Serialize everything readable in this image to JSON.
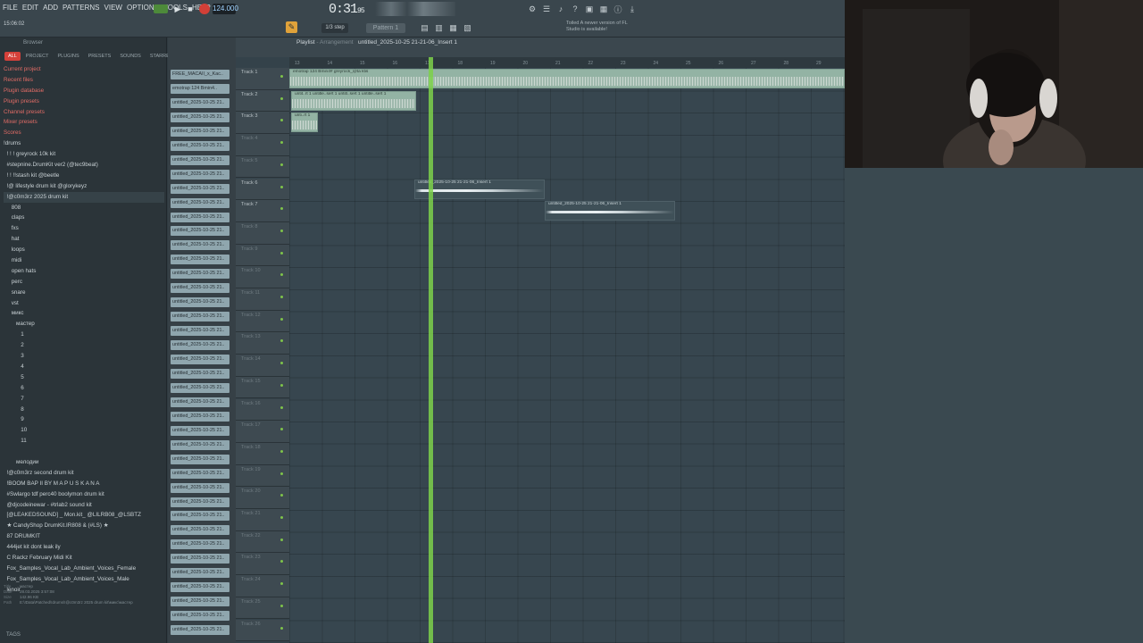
{
  "menu": [
    "FILE",
    "EDIT",
    "ADD",
    "PATTERNS",
    "VIEW",
    "OPTIONS",
    "TOOLS",
    "HELP"
  ],
  "transport": {
    "tempo": "124.000",
    "time": "0:31",
    "time_small": "95",
    "song_pos": "15:06:02",
    "pattern": "Pattern 1",
    "snap": "1/3 step",
    "hint": "Toiled A newer version of FL Studio is available!"
  },
  "browser": {
    "title": "Browser",
    "tabs": [
      "ALL",
      "PROJECT",
      "PLUGINS",
      "PRESETS",
      "SOUNDS",
      "STARRED"
    ],
    "tree": [
      {
        "label": "Current project",
        "red": true
      },
      {
        "label": "Recent files",
        "red": true
      },
      {
        "label": "Plugin database",
        "red": true
      },
      {
        "label": "Plugin presets",
        "red": true
      },
      {
        "label": "Channel presets",
        "red": true
      },
      {
        "label": "Mixer presets",
        "red": true
      },
      {
        "label": "Scores",
        "red": true
      },
      {
        "label": "!drums"
      },
      {
        "label": "  ! ! ! greyrock 10k kit"
      },
      {
        "label": "  #stepnine.DrumKit ver2 (@tec9beat)"
      },
      {
        "label": "  ! ! !!stash kit @beetle"
      },
      {
        "label": "  !@ lifestyle drum kit @glorykeyz"
      },
      {
        "label": "  !@c0m3rz 2025 drum kit",
        "sel": true
      },
      {
        "label": "     808"
      },
      {
        "label": "     claps"
      },
      {
        "label": "     fxs"
      },
      {
        "label": "     hat"
      },
      {
        "label": "     loops"
      },
      {
        "label": "     midi"
      },
      {
        "label": "     open hats"
      },
      {
        "label": "     perc"
      },
      {
        "label": "     snare"
      },
      {
        "label": "     vst"
      },
      {
        "label": "     микс"
      },
      {
        "label": "        мастер"
      },
      {
        "label": "           1"
      },
      {
        "label": "           2"
      },
      {
        "label": "           3"
      },
      {
        "label": "           4"
      },
      {
        "label": "           5"
      },
      {
        "label": "           6"
      },
      {
        "label": "           7"
      },
      {
        "label": "           8"
      },
      {
        "label": "           9"
      },
      {
        "label": "           10"
      },
      {
        "label": "           11"
      },
      {
        "label": ""
      },
      {
        "label": "        мелодии"
      },
      {
        "label": "  !@c0m3rz second drum kit"
      },
      {
        "label": "  !BOOM BAP II BY M A P U S K A N A"
      },
      {
        "label": "  #Swlargo tdf perc40 boolymon drum kit"
      },
      {
        "label": "  @djcodeinewar - #trlab2 sound kit"
      },
      {
        "label": "  [@LEAKEDSOUND] _ Mon.kit_ @LILRB08_@LSBTZ"
      },
      {
        "label": "  ★ CandyShop DrumKit.IR808 & (#LS) ★"
      },
      {
        "label": "  87 DRUMKIT"
      },
      {
        "label": "  444jet kit dont leak ily"
      },
      {
        "label": "  C Rackz February Midi Kit"
      },
      {
        "label": "  Fox_Samples_Vocal_Lab_Ambient_Voices_Female"
      },
      {
        "label": "  Fox_Samples_Vocal_Lab_Ambient_Voices_Male"
      },
      {
        "label": "  lenoir"
      }
    ],
    "info": [
      {
        "k": "Title",
        "v": "мастер"
      },
      {
        "k": "Date",
        "v": "28.03.2025 3:57:08"
      },
      {
        "k": "Size",
        "v": "142.96 KB"
      },
      {
        "k": "Path",
        "v": "E:\\!Data\\Patched\\!drums\\!@c0m3rz 2025 drum kit\\микс\\мастер"
      }
    ],
    "footer": "TAGS"
  },
  "picker": {
    "items": [
      "FREE_MACAII_x_Kac..",
      "emotrap 124 Bmin4..",
      "untitled_2025-10-25 21..",
      "untitled_2025-10-25 21..",
      "untitled_2025-10-25 21..",
      "untitled_2025-10-25 21..",
      "untitled_2025-10-25 21..",
      "untitled_2025-10-25 21..",
      "untitled_2025-10-25 21..",
      "untitled_2025-10-25 21..",
      "untitled_2025-10-25 21..",
      "untitled_2025-10-25 21..",
      "untitled_2025-10-25 21..",
      "untitled_2025-10-25 21..",
      "untitled_2025-10-25 21..",
      "untitled_2025-10-25 21..",
      "untitled_2025-10-25 21..",
      "untitled_2025-10-25 21..",
      "untitled_2025-10-25 21..",
      "untitled_2025-10-25 21..",
      "untitled_2025-10-25 21..",
      "untitled_2025-10-25 21..",
      "untitled_2025-10-25 21..",
      "untitled_2025-10-25 21..",
      "untitled_2025-10-25 21..",
      "untitled_2025-10-25 21..",
      "untitled_2025-10-25 21..",
      "untitled_2025-10-25 21..",
      "untitled_2025-10-25 21..",
      "untitled_2025-10-25 21..",
      "untitled_2025-10-25 21..",
      "untitled_2025-10-25 21..",
      "untitled_2025-10-25 21..",
      "untitled_2025-10-25 21..",
      "untitled_2025-10-25 21..",
      "untitled_2025-10-25 21..",
      "untitled_2025-10-25 21..",
      "untitled_2025-10-25 21..",
      "untitled_2025-10-25 21..",
      "untitled_2025-10-25 21.."
    ]
  },
  "playlist": {
    "title": "Playlist",
    "subtitle": "- Arrangement",
    "pattern": "untitled_2025-10-25 21-21-06_Insert 1",
    "ruler": [
      "13",
      "14",
      "15",
      "16",
      "17",
      "18",
      "19",
      "20",
      "21",
      "22",
      "23",
      "24",
      "25",
      "26",
      "27",
      "28",
      "29"
    ],
    "tracks": [
      "Track 1",
      "Track 2",
      "Track 3",
      "Track 4",
      "Track 5",
      "Track 6",
      "Track 7",
      "Track 8",
      "Track 9",
      "Track 10",
      "Track 11",
      "Track 12",
      "Track 13",
      "Track 14",
      "Track 15",
      "Track 16",
      "Track 17",
      "Track 18",
      "Track 19",
      "Track 20",
      "Track 21",
      "Track 22",
      "Track 23",
      "Track 24",
      "Track 25",
      "Track 26"
    ],
    "clips": [
      {
        "label": "emotrap 124 Bmin4# greyrock_@ta ktis",
        "track": 0,
        "dark": false
      },
      {
        "label": "untit..rt 1  untitle..sert 1  untitl..sert 1  untitle..sert 1",
        "track": 1,
        "dark": false
      },
      {
        "label": "unti..rt 1",
        "track": 2,
        "dark": false
      },
      {
        "label": "untitled_2025-10-25 21-21-06_Insert 1",
        "track": 5,
        "dark": true
      },
      {
        "label": "untitled_2025-10-25 21-21-06_Insert 1",
        "track": 6,
        "dark": true
      }
    ]
  }
}
